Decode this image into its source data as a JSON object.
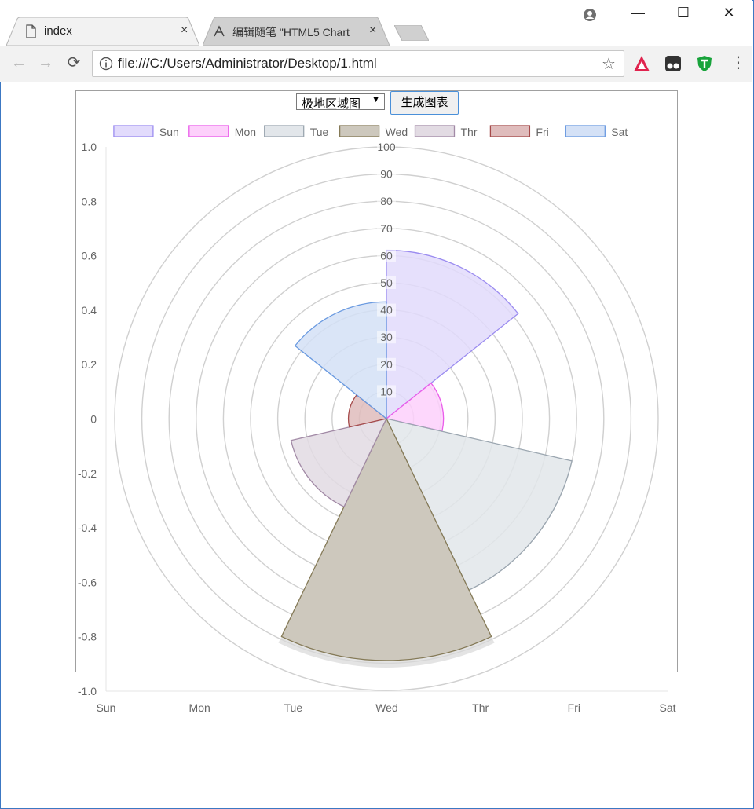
{
  "browser": {
    "tabs": [
      {
        "title": "index",
        "close": "×"
      },
      {
        "title": "编辑随笔 \"HTML5 Chart",
        "close": "×"
      }
    ],
    "window_controls": {
      "minimize": "—",
      "maximize": "☐",
      "close": "✕"
    },
    "nav": {
      "back": "←",
      "forward": "→",
      "reload": "⟳"
    },
    "address_bar": {
      "url": "file:///C:/Users/Administrator/Desktop/1.html",
      "star": "☆"
    },
    "menu": "⋮"
  },
  "controls": {
    "chart_type_select": {
      "value": "极地区域图",
      "arrow": "▼"
    },
    "generate_button": "生成图表"
  },
  "colors": {
    "accent": "#3c78c3",
    "grid": "#d0d0d0",
    "tick_text": "#666666"
  },
  "chart_data": {
    "type": "polarArea",
    "labels": [
      "Sun",
      "Mon",
      "Tue",
      "Wed",
      "Thr",
      "Fri",
      "Sat"
    ],
    "values": [
      62,
      21,
      70,
      89,
      36,
      14,
      43
    ],
    "colors": [
      {
        "fill": "#e2dbfc",
        "stroke": "#9b8cf0"
      },
      {
        "fill": "#fdd0fb",
        "stroke": "#ea5cea"
      },
      {
        "fill": "#e2e6ea",
        "stroke": "#9ba6b0"
      },
      {
        "fill": "#cdc8bd",
        "stroke": "#857a57"
      },
      {
        "fill": "#e2dbe3",
        "stroke": "#a28aa6"
      },
      {
        "fill": "#dfbcbc",
        "stroke": "#a54a4a"
      },
      {
        "fill": "#d4e1f6",
        "stroke": "#6a9ae0"
      }
    ],
    "radial_scale": {
      "min": 0,
      "max": 100,
      "ticks": [
        10,
        20,
        30,
        40,
        50,
        60,
        70,
        80,
        90,
        100
      ]
    },
    "y_axis": {
      "min": -1.0,
      "max": 1.0,
      "ticks": [
        "1.0",
        "0.8",
        "0.6",
        "0.4",
        "0.2",
        "0",
        "-0.2",
        "-0.4",
        "-0.6",
        "-0.8",
        "-1.0"
      ]
    },
    "x_axis": {
      "ticks": [
        "Sun",
        "Mon",
        "Tue",
        "Wed",
        "Thr",
        "Fri",
        "Sat"
      ]
    },
    "legend": {
      "position": "top",
      "labels": [
        "Sun",
        "Mon",
        "Tue",
        "Wed",
        "Thr",
        "Fri",
        "Sat"
      ]
    },
    "hovered_segment": "Wed",
    "grid": true
  }
}
